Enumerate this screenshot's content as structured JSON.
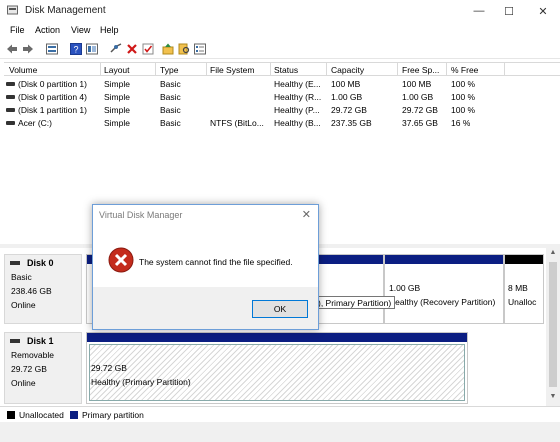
{
  "window": {
    "title": "Disk Management",
    "minimize": "—",
    "maximize": "☐",
    "close": "✕"
  },
  "menu": [
    "File",
    "Action",
    "View",
    "Help"
  ],
  "toolbar_icons": [
    "back-arrow-icon",
    "forward-arrow-icon",
    "disk-view-icon",
    "help-icon",
    "disk-list-icon",
    "connect-icon",
    "delete-icon",
    "check-icon",
    "import-icon",
    "search-icon",
    "properties-icon"
  ],
  "volumes": {
    "columns": [
      "Volume",
      "Layout",
      "Type",
      "File System",
      "Status",
      "Capacity",
      "Free Sp...",
      "% Free"
    ],
    "rows": [
      [
        "(Disk 0 partition 1)",
        "Simple",
        "Basic",
        "",
        "Healthy (E...",
        "100 MB",
        "100 MB",
        "100 %"
      ],
      [
        "(Disk 0 partition 4)",
        "Simple",
        "Basic",
        "",
        "Healthy (R...",
        "1.00 GB",
        "1.00 GB",
        "100 %"
      ],
      [
        "(Disk 1 partition 1)",
        "Simple",
        "Basic",
        "",
        "Healthy (P...",
        "29.72 GB",
        "29.72 GB",
        "100 %"
      ],
      [
        "Acer (C:)",
        "Simple",
        "Basic",
        "NTFS (BitLo...",
        "Healthy (B...",
        "237.35 GB",
        "37.65 GB",
        "16 %"
      ]
    ]
  },
  "disk0": {
    "name": "Disk 0",
    "type": "Basic",
    "size": "238.46 GB",
    "status": "Online",
    "partitions": {
      "recovery_size": "1.00 GB",
      "recovery_status": "Healthy (Recovery Partition)",
      "unalloc_size": "8 MB",
      "unalloc_label": "Unalloc"
    }
  },
  "disk1": {
    "name": "Disk 1",
    "type": "Removable",
    "size": "29.72 GB",
    "status": "Online",
    "partition_size": "29.72 GB",
    "partition_status": "Healthy (Primary Partition)"
  },
  "tooltip": "), Primary Partition)",
  "legend": {
    "unallocated": "Unallocated",
    "primary": "Primary partition"
  },
  "colors": {
    "primary": "#0b1e82",
    "unallocated": "#000000"
  },
  "dialog": {
    "title": "Virtual Disk Manager",
    "message": "The system cannot find the file specified.",
    "ok": "OK"
  }
}
